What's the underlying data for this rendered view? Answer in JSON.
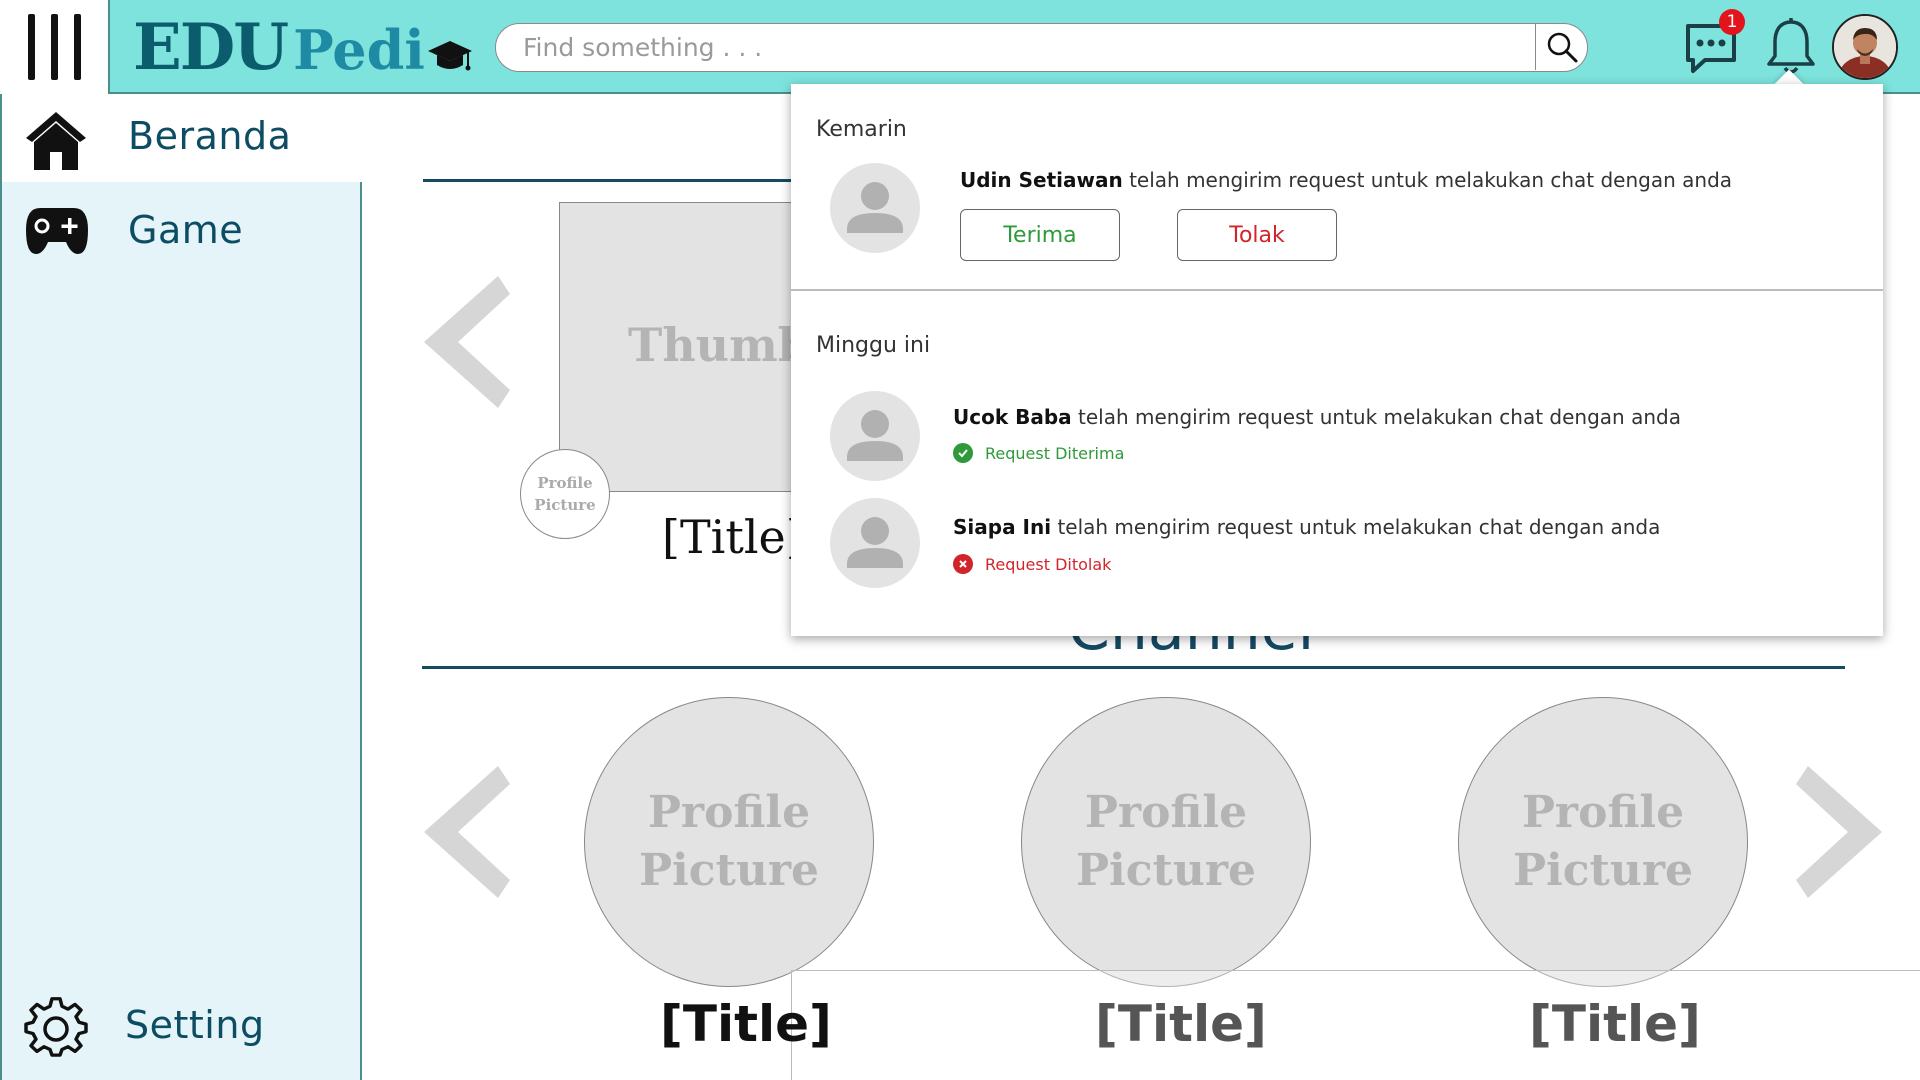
{
  "header": {
    "logo_edu": "EDU",
    "logo_pedi": "Pedi",
    "search_placeholder": "Find something . . .",
    "chat_badge_count": "1"
  },
  "sidebar": {
    "items": [
      {
        "label": "Beranda",
        "icon": "home-icon",
        "active": true
      },
      {
        "label": "Game",
        "icon": "gamepad-icon",
        "active": false
      }
    ],
    "setting_label": "Setting"
  },
  "main": {
    "thumbnail_text": "Thumbn",
    "small_profile_line1": "Profile",
    "small_profile_line2": "Picture",
    "featured_title": "[Title]",
    "section_title": "Channel",
    "channels": [
      {
        "line1": "Profile",
        "line2": "Picture",
        "title": "[Title]"
      },
      {
        "line1": "Profile",
        "line2": "Picture",
        "title": "[Title]"
      },
      {
        "line1": "Profile",
        "line2": "Picture",
        "title": "[Title]"
      }
    ]
  },
  "notifications": {
    "group_yesterday": "Kemarin",
    "group_week": "Minggu ini",
    "items": [
      {
        "name": "Udin Setiawan",
        "message": "telah mengirim request untuk melakukan chat dengan anda",
        "accept_label": "Terima",
        "reject_label": "Tolak"
      },
      {
        "name": "Ucok Baba",
        "message": "telah mengirim request untuk melakukan chat dengan anda",
        "status": "Request Diterima"
      },
      {
        "name": "Siapa Ini",
        "message": "telah mengirim request untuk melakukan chat dengan anda",
        "status": "Request Ditolak"
      }
    ]
  },
  "colors": {
    "header_bg": "#7de3dc",
    "sidebar_bg": "#e4f4f8",
    "accent_dark": "#154a63",
    "accept_green": "#2e9a3a",
    "reject_red": "#d0262b"
  }
}
